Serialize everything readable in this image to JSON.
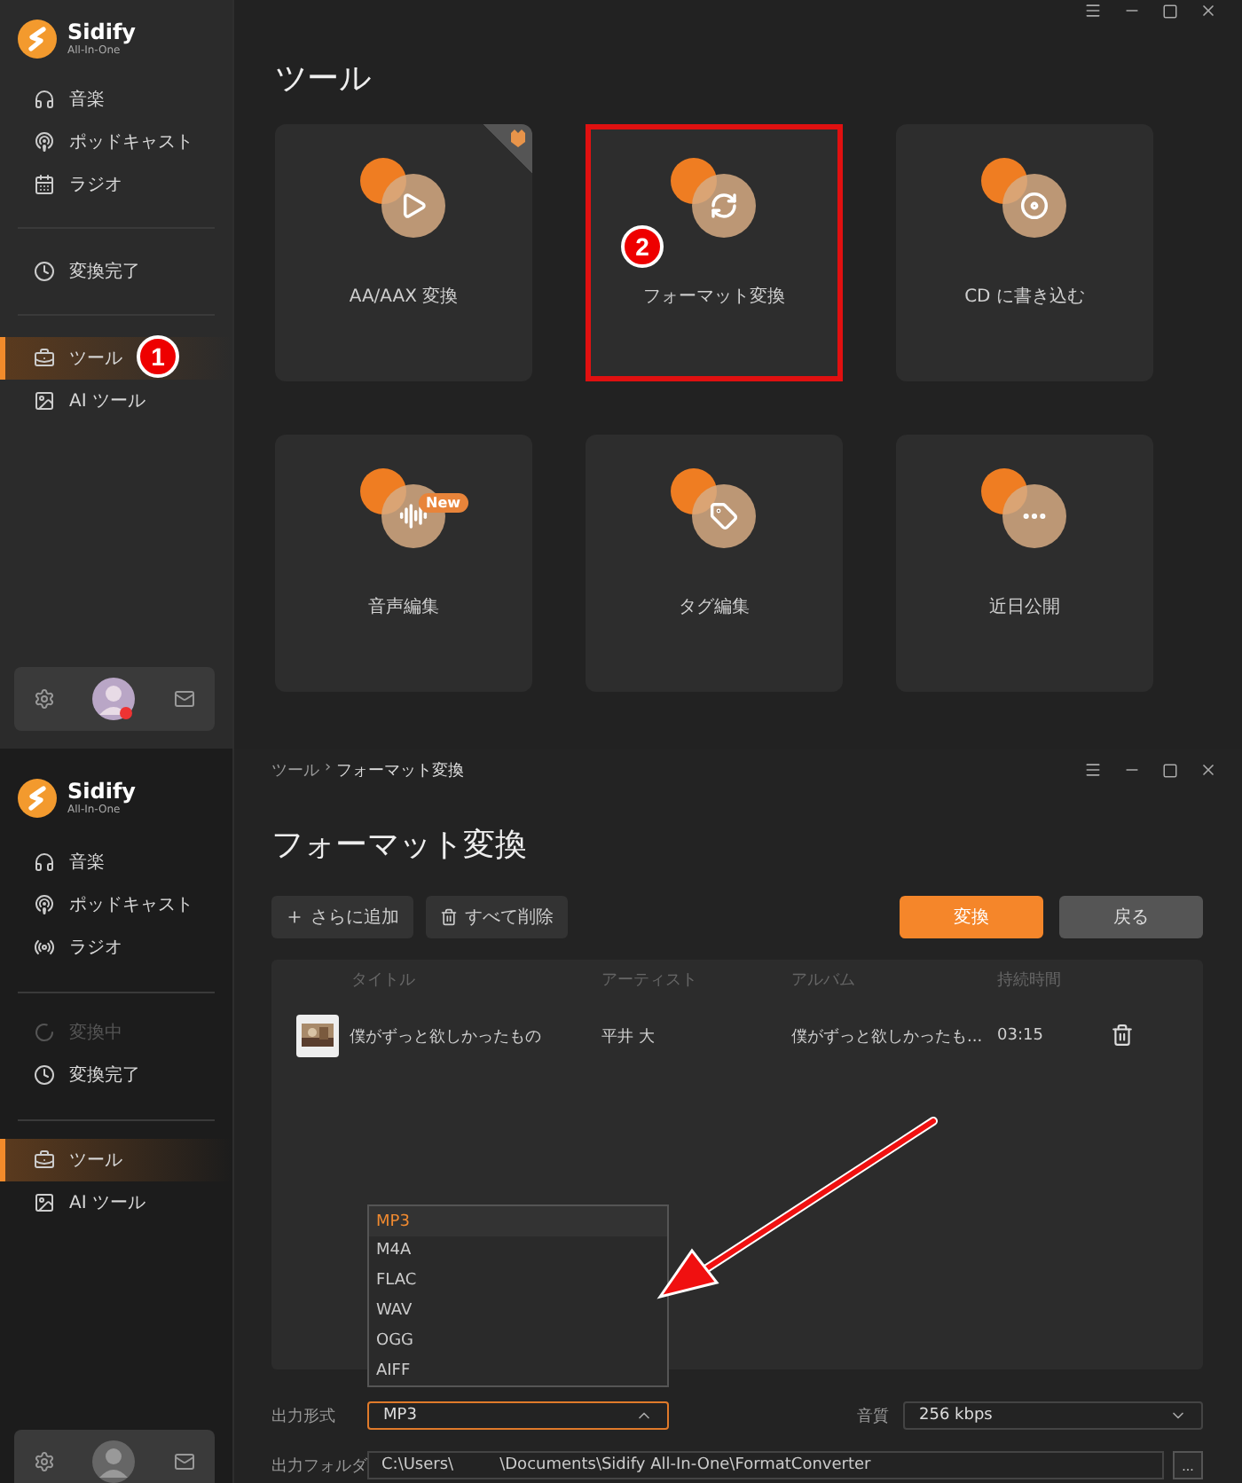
{
  "tools_screen": {
    "sidebar": {
      "brand": {
        "name": "Sidify",
        "tagline": "All-In-One"
      },
      "groups": [
        [
          {
            "label": "音楽",
            "selected": false,
            "disabled": false
          },
          {
            "label": "ポッドキャスト",
            "selected": false,
            "disabled": false
          },
          {
            "label": "ラジオ",
            "selected": false,
            "disabled": false
          }
        ],
        [
          {
            "label": "変換完了",
            "selected": false,
            "disabled": false
          }
        ],
        [
          {
            "label": "ツール",
            "selected": true,
            "disabled": false,
            "marker": "1"
          },
          {
            "label": "AI ツール",
            "selected": false,
            "disabled": false
          }
        ]
      ]
    },
    "title": "ツール",
    "cards": [
      {
        "label": "AA/AAX 変換",
        "highlighted": false,
        "corner": true
      },
      {
        "label": "フォーマット変換",
        "highlighted": true,
        "marker": "2"
      },
      {
        "label": "CD に書き込む",
        "highlighted": false
      },
      {
        "label": "音声編集",
        "highlighted": false,
        "badge": "New"
      },
      {
        "label": "タグ編集",
        "highlighted": false
      },
      {
        "label": "近日公開",
        "highlighted": false
      }
    ]
  },
  "converter_screen": {
    "sidebar": {
      "brand": {
        "name": "Sidify",
        "tagline": "All-In-One"
      },
      "groups": [
        [
          {
            "label": "音楽",
            "selected": false,
            "disabled": false
          },
          {
            "label": "ポッドキャスト",
            "selected": false,
            "disabled": false
          },
          {
            "label": "ラジオ",
            "selected": false,
            "disabled": false
          }
        ],
        [
          {
            "label": "変換中",
            "selected": false,
            "disabled": true
          },
          {
            "label": "変換完了",
            "selected": false,
            "disabled": false
          }
        ],
        [
          {
            "label": "ツール",
            "selected": true,
            "disabled": false
          },
          {
            "label": "AI ツール",
            "selected": false,
            "disabled": false
          }
        ]
      ]
    },
    "breadcrumb": {
      "parent": "ツール",
      "separator": "›",
      "current": "フォーマット変換"
    },
    "title": "フォーマット変換",
    "actions": [
      {
        "label": "さらに追加"
      },
      {
        "label": "すべて削除"
      }
    ],
    "convert_button": "変換",
    "back_button": "戻る",
    "table": {
      "columns": [
        "タイトル",
        "アーティスト",
        "アルバム",
        "持続時間"
      ],
      "rows": [
        {
          "title": "僕がずっと欲しかったもの",
          "artist": "平井 大",
          "album": "僕がずっと欲しかったも...",
          "duration": "03:15"
        }
      ]
    },
    "output_format": {
      "label": "出力形式",
      "value": "MP3",
      "expanded": true,
      "options": [
        {
          "label": "MP3",
          "selected": true
        },
        {
          "label": "M4A",
          "selected": false
        },
        {
          "label": "FLAC",
          "selected": false
        },
        {
          "label": "WAV",
          "selected": false
        },
        {
          "label": "OGG",
          "selected": false
        },
        {
          "label": "AIFF",
          "selected": false
        }
      ]
    },
    "quality": {
      "label": "音質",
      "value": "256 kbps"
    },
    "output_folder": {
      "label": "出力フォルダ",
      "path_start": "C:\\Users\\",
      "path_end": "\\Documents\\Sidify All-In-One\\FormatConverter",
      "browse": "..."
    }
  }
}
